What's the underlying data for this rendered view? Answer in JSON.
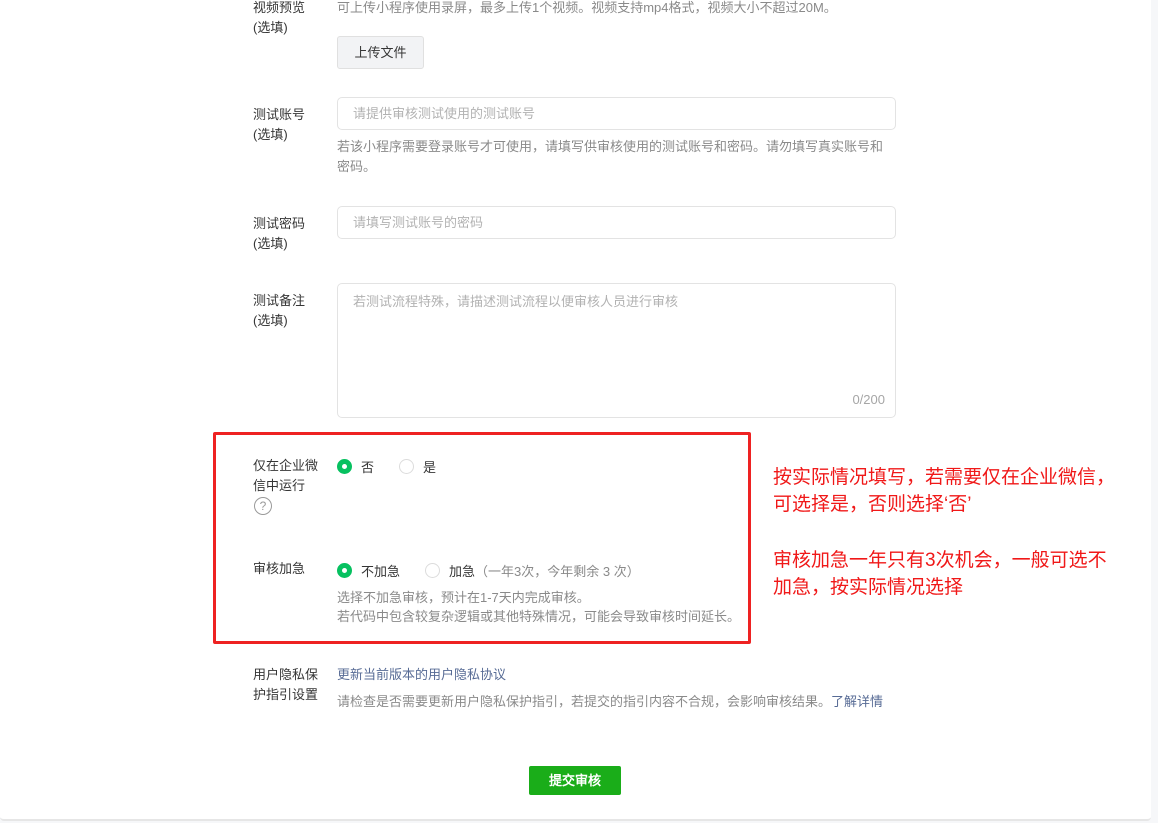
{
  "video_preview": {
    "label": "视频预览\n(选填)",
    "label_line1": "视频预览",
    "label_line2": "(选填)",
    "tip": "可上传小程序使用录屏，最多上传1个视频。视频支持mp4格式，视频大小不超过20M。",
    "upload_button": "上传文件"
  },
  "test_account": {
    "label_line1": "测试账号",
    "label_line2": "(选填)",
    "placeholder": "请提供审核测试使用的测试账号",
    "value": "",
    "tip": "若该小程序需要登录账号才可使用，请填写供审核使用的测试账号和密码。请勿填写真实账号和密码。"
  },
  "test_password": {
    "label_line1": "测试密码",
    "label_line2": "(选填)",
    "placeholder": "请填写测试账号的密码",
    "value": ""
  },
  "test_notes": {
    "label_line1": "测试备注",
    "label_line2": "(选填)",
    "placeholder": "若测试流程特殊，请描述测试流程以便审核人员进行审核",
    "value": "",
    "counter": "0/200"
  },
  "enterprise_wechat_only": {
    "label_line1": "仅在企业微",
    "label_line2": "信中运行",
    "help_icon": "?",
    "options": [
      {
        "label": "否",
        "checked": true
      },
      {
        "label": "是",
        "checked": false
      }
    ]
  },
  "urgent_review": {
    "label": "审核加急",
    "options": [
      {
        "label": "不加急",
        "checked": true,
        "sub": ""
      },
      {
        "label": "加急",
        "checked": false,
        "sub": "（一年3次，今年剩余  3  次）"
      }
    ],
    "tip_line1": "选择不加急审核，预计在1-7天内完成审核。",
    "tip_line2": "若代码中包含较复杂逻辑或其他特殊情况，可能会导致审核时间延长。"
  },
  "privacy": {
    "label_line1": "用户隐私保",
    "label_line2": "护指引设置",
    "update_link": "更新当前版本的用户隐私协议",
    "tip": "请检查是否需要更新用户隐私保护指引，若提交的指引内容不合规，会影响审核结果。",
    "learn_more": "了解详情"
  },
  "submit_button": "提交审核",
  "annotations": {
    "note1_line1": "按实际情况填写，若需要仅在企业微信，",
    "note1_line2": "可选择是，否则选择‘否’",
    "note2_line1": "审核加急一年只有3次机会，一般可选不",
    "note2_line2": "加急，按实际情况选择",
    "color": "#f01818"
  },
  "colors": {
    "accent_green": "#07c160",
    "submit_green": "#1aad19",
    "link_blue": "#576b95",
    "annotation_red": "#ee2222"
  }
}
